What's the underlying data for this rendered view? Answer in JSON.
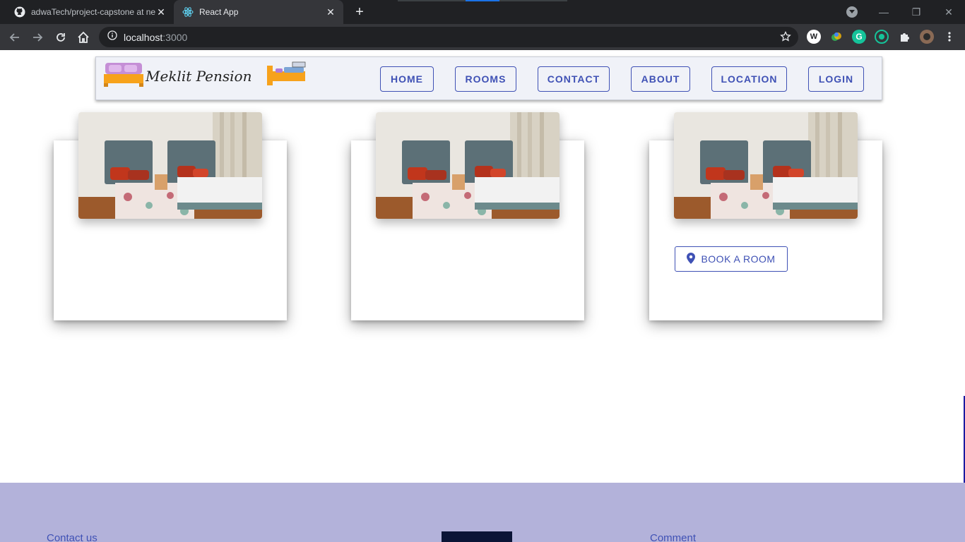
{
  "browser": {
    "tabs": [
      {
        "title": "adwaTech/project-capstone at ne",
        "icon": "github-icon"
      },
      {
        "title": "React App",
        "icon": "react-icon",
        "active": true
      }
    ],
    "address": {
      "host": "localhost",
      "port": ":3000"
    }
  },
  "site": {
    "brand": "Meklit Pension",
    "nav": [
      "HOME",
      "ROOMS",
      "CONTACT",
      "ABOUT",
      "LOCATION",
      "LOGIN"
    ],
    "cards": [
      {
        "image": "bedroom-photo"
      },
      {
        "image": "bedroom-photo"
      },
      {
        "image": "bedroom-photo",
        "button": "BOOK A ROOM"
      }
    ],
    "footer": {
      "contact_heading": "Contact us",
      "comment_heading": "Comment"
    }
  },
  "colors": {
    "primary": "#3f51b5",
    "footer_bg": "#b3b2da",
    "navbar_bg": "#f0f2f8"
  }
}
